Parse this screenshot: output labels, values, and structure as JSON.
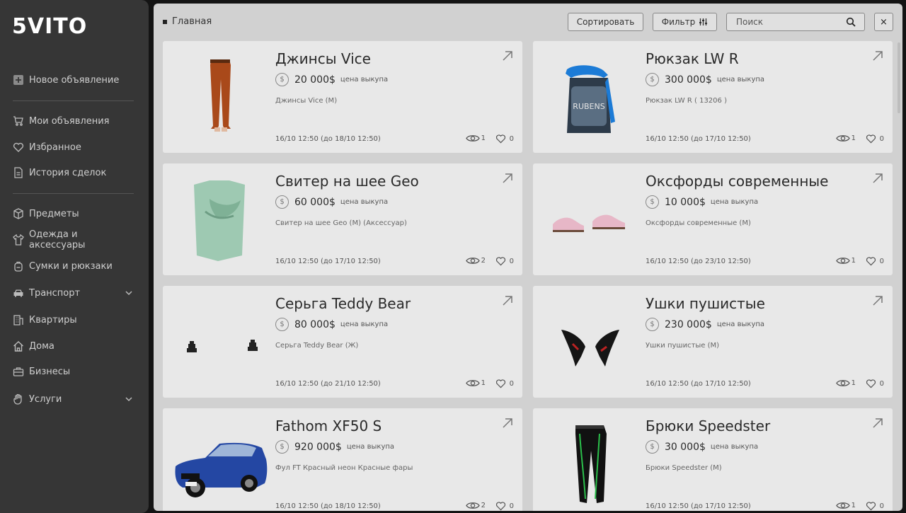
{
  "app": {
    "logo": "5VITO"
  },
  "sidebar": {
    "items": [
      {
        "label": "Новое объявление",
        "icon": "plus-square-icon"
      },
      {
        "label": "Мои объявления",
        "icon": "cart-icon"
      },
      {
        "label": "Избранное",
        "icon": "heart-icon"
      },
      {
        "label": "История сделок",
        "icon": "document-icon"
      },
      {
        "label": "Предметы",
        "icon": "box-icon"
      },
      {
        "label": "Одежда и аксессуары",
        "icon": "tshirt-icon"
      },
      {
        "label": "Сумки и рюкзаки",
        "icon": "backpack-icon"
      },
      {
        "label": "Транспорт",
        "icon": "car-icon"
      },
      {
        "label": "Квартиры",
        "icon": "building-icon"
      },
      {
        "label": "Дома",
        "icon": "house-icon"
      },
      {
        "label": "Бизнесы",
        "icon": "briefcase-icon"
      },
      {
        "label": "Услуги",
        "icon": "hand-icon"
      }
    ]
  },
  "header": {
    "breadcrumb": "Главная",
    "sort_label": "Сортировать",
    "filter_label": "Фильтр",
    "search_placeholder": "Поиск",
    "close_label": "×"
  },
  "listings": [
    {
      "title": "Джинсы Vice",
      "price": "20 000$",
      "price_label": "цена выкупа",
      "desc": "Джинсы Vice (M)",
      "date": "16/10 12:50 (до 18/10 12:50)",
      "views": "1",
      "likes": "0",
      "image": "jeans"
    },
    {
      "title": "Рюкзак LW R",
      "price": "300 000$",
      "price_label": "цена выкупа",
      "desc": "Рюкзак LW R ( 13206 )",
      "date": "16/10 12:50 (до 17/10 12:50)",
      "views": "1",
      "likes": "0",
      "image": "backpack"
    },
    {
      "title": "Свитер на шее Geo",
      "price": "60 000$",
      "price_label": "цена выкупа",
      "desc": "Свитер на шее Geo (M) (Аксессуар)",
      "date": "16/10 12:50 (до 17/10 12:50)",
      "views": "2",
      "likes": "0",
      "image": "sweater"
    },
    {
      "title": "Оксфорды современные",
      "price": "10 000$",
      "price_label": "цена выкупа",
      "desc": "Оксфорды современные (M)",
      "date": "16/10 12:50 (до 23/10 12:50)",
      "views": "1",
      "likes": "0",
      "image": "shoes"
    },
    {
      "title": "Серьга Teddy Bear",
      "price": "80 000$",
      "price_label": "цена выкупа",
      "desc": "Серьга Teddy Bear (Ж)",
      "date": "16/10 12:50 (до 21/10 12:50)",
      "views": "1",
      "likes": "0",
      "image": "earrings"
    },
    {
      "title": "Ушки пушистые",
      "price": "230 000$",
      "price_label": "цена выкупа",
      "desc": "Ушки пушистые (M)",
      "date": "16/10 12:50 (до 17/10 12:50)",
      "views": "1",
      "likes": "0",
      "image": "ears"
    },
    {
      "title": "Fathom XF50 S",
      "price": "920 000$",
      "price_label": "цена выкупа",
      "desc": "Фул FT Красный неон Красные фары",
      "date": "16/10 12:50 (до 18/10 12:50)",
      "views": "2",
      "likes": "0",
      "image": "car"
    },
    {
      "title": "Брюки Speedster",
      "price": "30 000$",
      "price_label": "цена выкупа",
      "desc": "Брюки Speedster (M)",
      "date": "16/10 12:50 (до 17/10 12:50)",
      "views": "1",
      "likes": "0",
      "image": "pants"
    }
  ]
}
